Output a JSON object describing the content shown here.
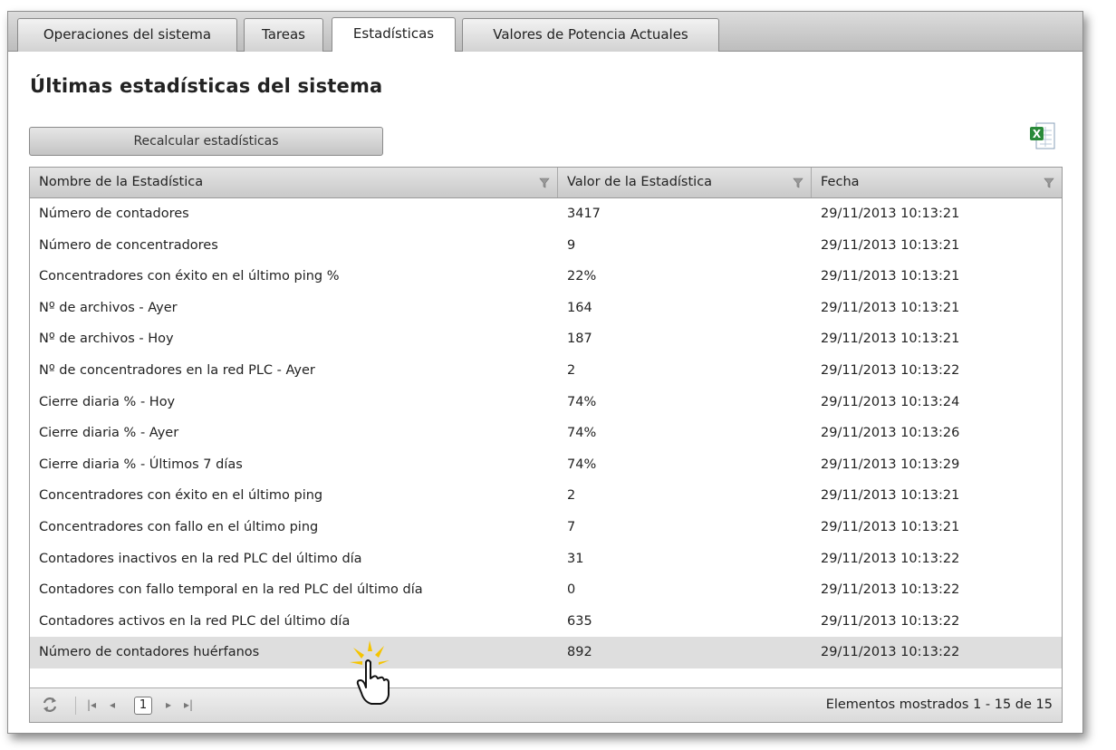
{
  "tabs": [
    {
      "label": "Operaciones del sistema",
      "active": false
    },
    {
      "label": "Tareas",
      "active": false
    },
    {
      "label": "Estadísticas",
      "active": true
    },
    {
      "label": "Valores de Potencia Actuales",
      "active": false
    }
  ],
  "page": {
    "title": "Últimas estadísticas del sistema",
    "recalculate_label": "Recalcular estadísticas",
    "export_icon": "excel-export-icon"
  },
  "grid": {
    "columns": [
      "Nombre de la Estadística",
      "Valor de la Estadística",
      "Fecha"
    ],
    "rows": [
      {
        "name": "Número de contadores",
        "value": "3417",
        "date": "29/11/2013 10:13:21"
      },
      {
        "name": "Número de concentradores",
        "value": "9",
        "date": "29/11/2013 10:13:21"
      },
      {
        "name": "Concentradores con éxito en el último ping %",
        "value": "22%",
        "date": "29/11/2013 10:13:21"
      },
      {
        "name": "Nº de archivos - Ayer",
        "value": "164",
        "date": "29/11/2013 10:13:21"
      },
      {
        "name": "Nº de archivos - Hoy",
        "value": "187",
        "date": "29/11/2013 10:13:21"
      },
      {
        "name": "Nº de concentradores en la red PLC - Ayer",
        "value": "2",
        "date": "29/11/2013 10:13:22"
      },
      {
        "name": "Cierre diaria % - Hoy",
        "value": "74%",
        "date": "29/11/2013 10:13:24"
      },
      {
        "name": "Cierre diaria % - Ayer",
        "value": "74%",
        "date": "29/11/2013 10:13:26"
      },
      {
        "name": "Cierre diaria % - Últimos 7 días",
        "value": "74%",
        "date": "29/11/2013 10:13:29"
      },
      {
        "name": "Concentradores con éxito en el último ping",
        "value": "2",
        "date": "29/11/2013 10:13:21"
      },
      {
        "name": "Concentradores con fallo en el último ping",
        "value": "7",
        "date": "29/11/2013 10:13:21"
      },
      {
        "name": "Contadores inactivos en la red PLC del último día",
        "value": "31",
        "date": "29/11/2013 10:13:22"
      },
      {
        "name": "Contadores con fallo temporal en la red PLC del último día",
        "value": "0",
        "date": "29/11/2013 10:13:22"
      },
      {
        "name": "Contadores activos en la red PLC del último día",
        "value": "635",
        "date": "29/11/2013 10:13:22"
      },
      {
        "name": "Número de contadores huérfanos",
        "value": "892",
        "date": "29/11/2013 10:13:22",
        "highlighted": true
      }
    ]
  },
  "pager": {
    "current_page": "1",
    "info": "Elementos mostrados 1 - 15 de 15",
    "icons": [
      "refresh-icon",
      "first-page-icon",
      "prev-page-icon",
      "next-page-icon",
      "last-page-icon"
    ]
  },
  "colors": {
    "header_bg": "#d6d6d6",
    "highlight_row": "#dedede",
    "excel_green": "#2a8a3a"
  }
}
